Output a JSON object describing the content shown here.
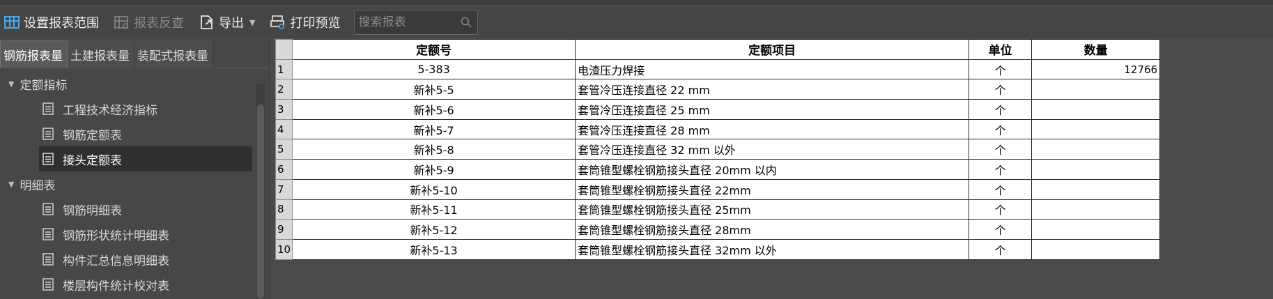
{
  "toolbar": {
    "set_range_label": "设置报表范围",
    "report_query_label": "报表反查",
    "export_label": "导出",
    "print_preview_label": "打印预览",
    "search_placeholder": "搜索报表"
  },
  "left_panel": {
    "tabs": [
      {
        "label": "钢筋报表量"
      },
      {
        "label": "土建报表量"
      },
      {
        "label": "装配式报表量"
      }
    ],
    "groups": [
      {
        "label": "定额指标",
        "items": [
          {
            "label": "工程技术经济指标"
          },
          {
            "label": "钢筋定额表"
          },
          {
            "label": "接头定额表"
          }
        ]
      },
      {
        "label": "明细表",
        "items": [
          {
            "label": "钢筋明细表"
          },
          {
            "label": "钢筋形状统计明细表"
          },
          {
            "label": "构件汇总信息明细表"
          },
          {
            "label": "楼层构件统计校对表"
          }
        ]
      }
    ]
  },
  "table": {
    "headers": [
      "定额号",
      "定额项目",
      "单位",
      "数量"
    ],
    "rows": [
      {
        "num": "1",
        "code": "5-383",
        "item": "电渣压力焊接",
        "unit": "个",
        "qty": "12766"
      },
      {
        "num": "2",
        "code": "新补5-5",
        "item": "套管冷压连接直径 22 mm",
        "unit": "个",
        "qty": ""
      },
      {
        "num": "3",
        "code": "新补5-6",
        "item": "套管冷压连接直径 25 mm",
        "unit": "个",
        "qty": ""
      },
      {
        "num": "4",
        "code": "新补5-7",
        "item": "套管冷压连接直径 28 mm",
        "unit": "个",
        "qty": ""
      },
      {
        "num": "5",
        "code": "新补5-8",
        "item": "套管冷压连接直径 32 mm 以外",
        "unit": "个",
        "qty": ""
      },
      {
        "num": "6",
        "code": "新补5-9",
        "item": "套筒锥型螺栓钢筋接头直径 20mm 以内",
        "unit": "个",
        "qty": ""
      },
      {
        "num": "7",
        "code": "新补5-10",
        "item": "套筒锥型螺栓钢筋接头直径 22mm",
        "unit": "个",
        "qty": ""
      },
      {
        "num": "8",
        "code": "新补5-11",
        "item": "套筒锥型螺栓钢筋接头直径 25mm",
        "unit": "个",
        "qty": ""
      },
      {
        "num": "9",
        "code": "新补5-12",
        "item": "套筒锥型螺栓钢筋接头直径 28mm",
        "unit": "个",
        "qty": ""
      },
      {
        "num": "10",
        "code": "新补5-13",
        "item": "套筒锥型螺栓钢筋接头直径 32mm 以外",
        "unit": "个",
        "qty": ""
      }
    ]
  },
  "icons": {
    "set_range": "grid-range-icon",
    "report_query": "grid-query-icon",
    "export": "export-icon",
    "print_preview": "print-preview-icon",
    "search": "search-icon",
    "report_item": "document-icon"
  }
}
